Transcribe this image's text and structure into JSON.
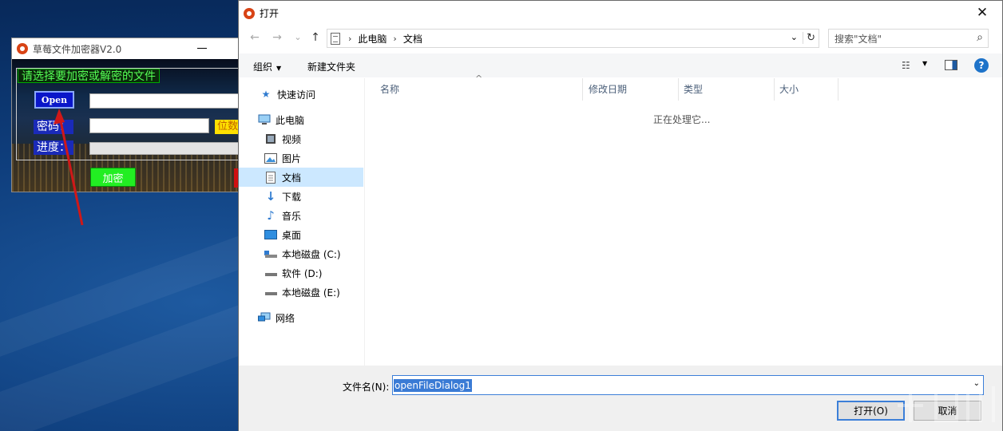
{
  "app": {
    "title": "草莓文件加密器V2.0",
    "prompt": "请选择要加密或解密的文件",
    "open_label": "Open",
    "password_label": "密码：",
    "bits_label": "位数",
    "progress_label": "进度：",
    "encrypt_label": "加密"
  },
  "dialog": {
    "title": "打开",
    "close_glyph": "✕",
    "nav": {
      "back": "←",
      "forward": "→",
      "recent": "⌄",
      "up": "↑"
    },
    "breadcrumb": [
      "此电脑",
      "文档"
    ],
    "breadcrumb_sep": "›",
    "search_placeholder": "搜索\"文档\"",
    "toolbar": {
      "organize": "组织",
      "new_folder": "新建文件夹",
      "help": "?"
    },
    "sidebar": [
      {
        "label": "快速访问",
        "icon": "star-icon"
      },
      {
        "label": "此电脑",
        "icon": "computer-icon"
      },
      {
        "label": "视频",
        "icon": "video-icon"
      },
      {
        "label": "图片",
        "icon": "picture-icon"
      },
      {
        "label": "文档",
        "icon": "document-icon",
        "selected": true
      },
      {
        "label": "下载",
        "icon": "download-icon"
      },
      {
        "label": "音乐",
        "icon": "music-icon"
      },
      {
        "label": "桌面",
        "icon": "desktop-icon"
      },
      {
        "label": "本地磁盘 (C:)",
        "icon": "drive-icon"
      },
      {
        "label": "软件 (D:)",
        "icon": "drive-icon"
      },
      {
        "label": "本地磁盘 (E:)",
        "icon": "drive-icon"
      },
      {
        "label": "网络",
        "icon": "network-icon"
      }
    ],
    "columns": [
      "名称",
      "修改日期",
      "类型",
      "大小"
    ],
    "status": "正在处理它...",
    "filename_label": "文件名(N):",
    "filename_value": "openFileDialog1",
    "open_button": "打开(O)",
    "cancel_button": "取消"
  },
  "colors": {
    "accent": "#3c7fd8",
    "selection": "#cce8ff",
    "open_button_bg": "#0a16c9",
    "encrypt_button_bg": "#22ee22",
    "arrow": "#d01818"
  }
}
